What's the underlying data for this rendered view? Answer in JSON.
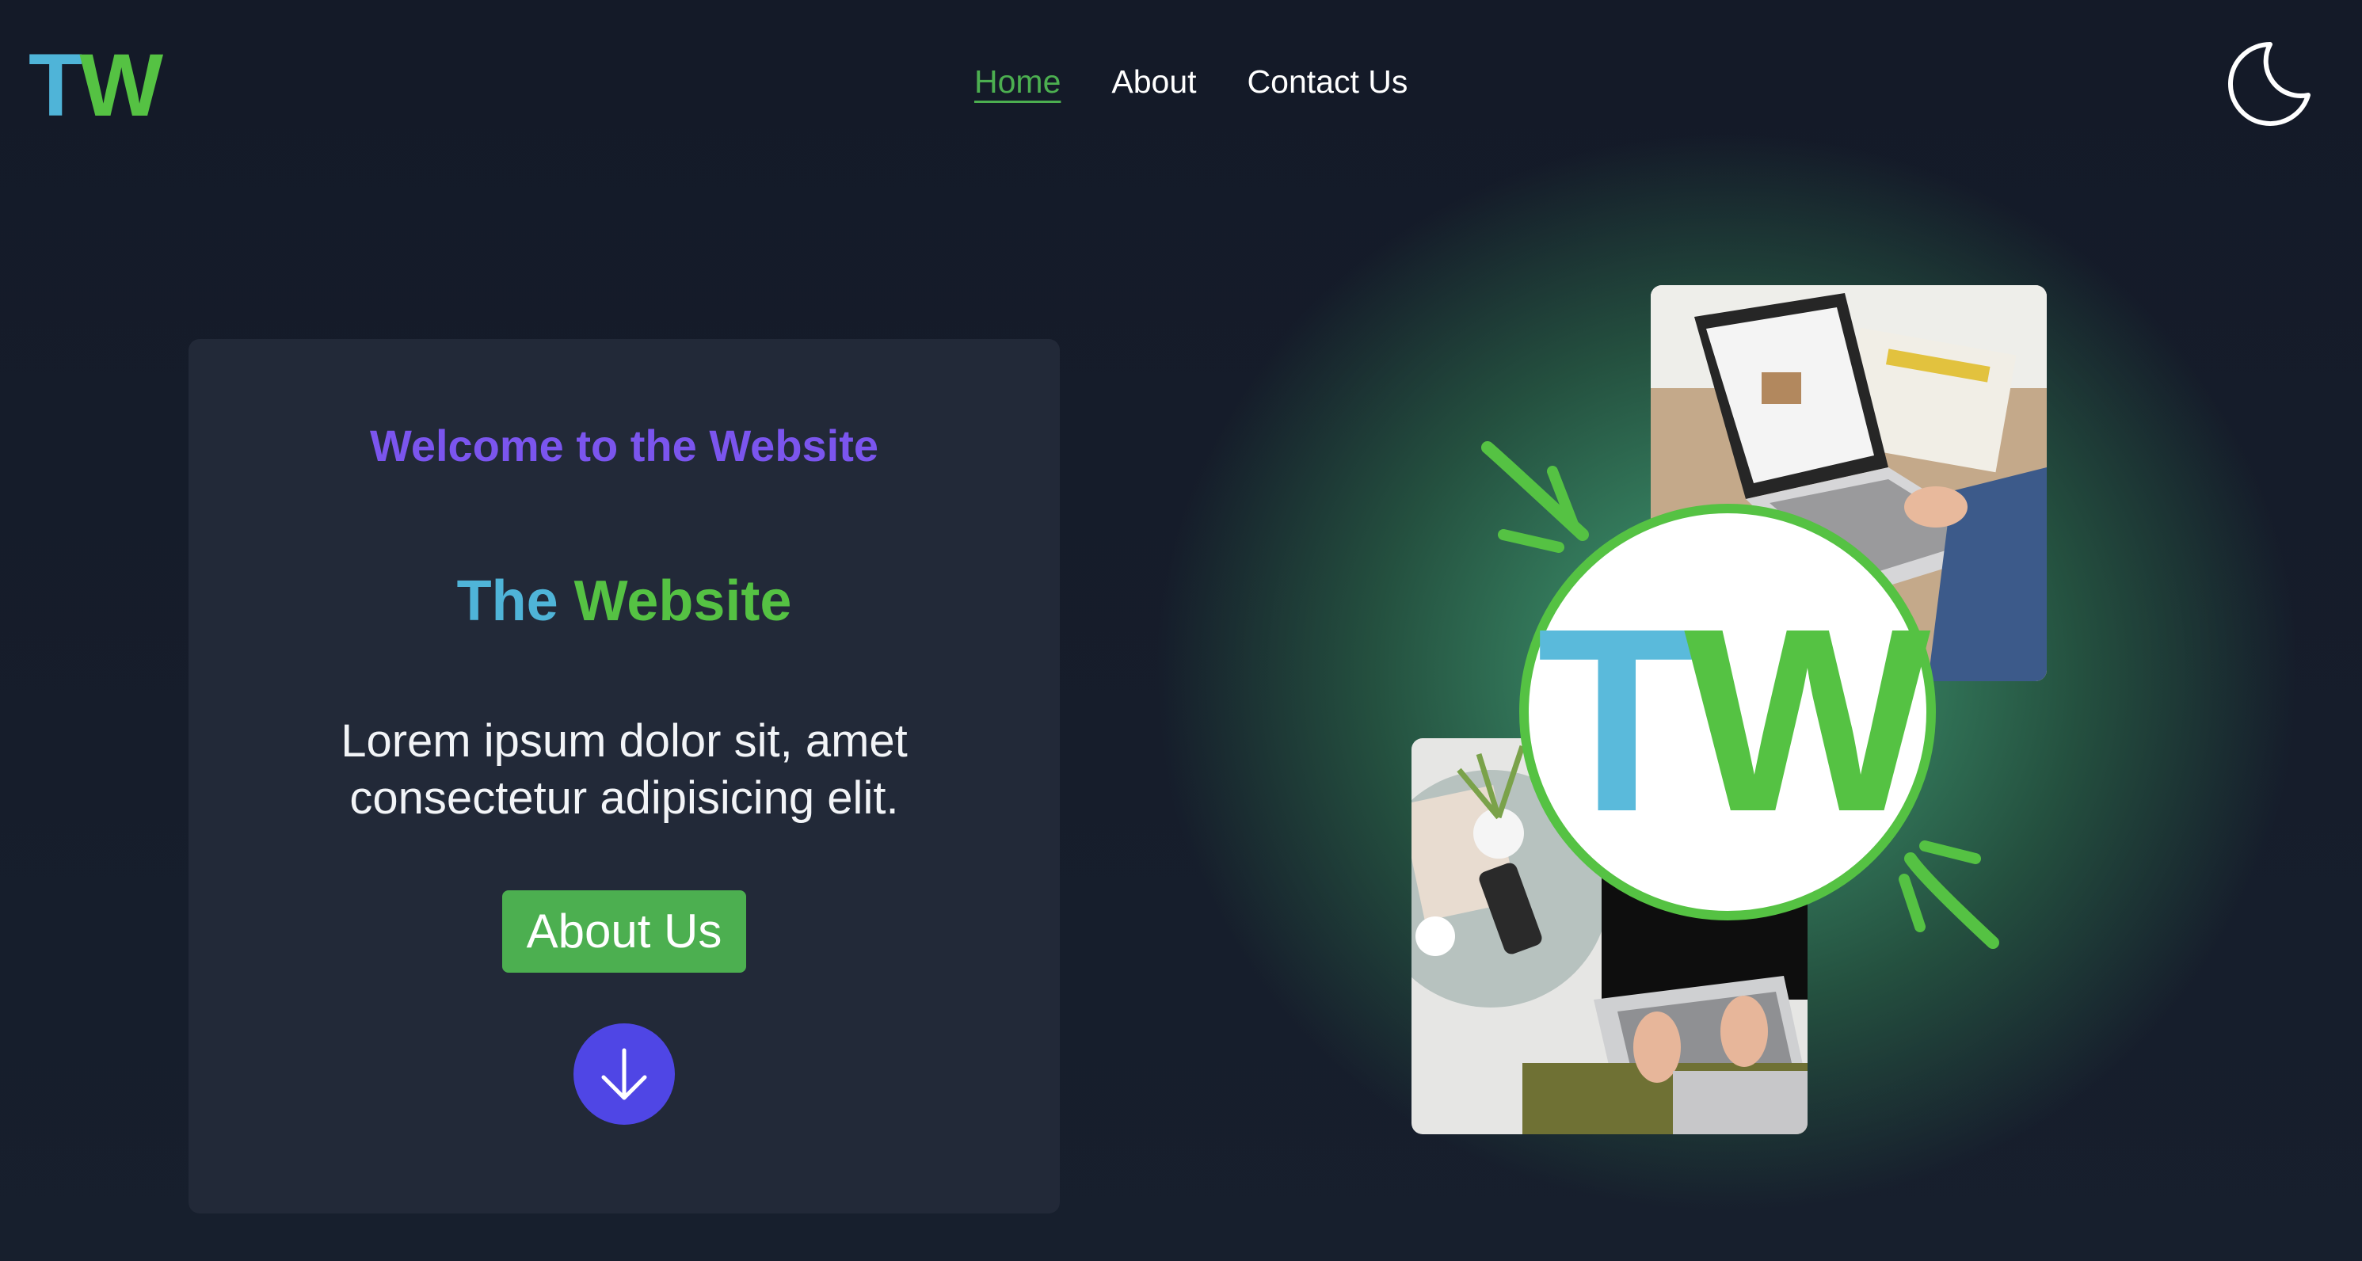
{
  "header": {
    "logo": {
      "t": "T",
      "w": "W"
    },
    "nav": [
      {
        "label": "Home",
        "active": true
      },
      {
        "label": "About",
        "active": false
      },
      {
        "label": "Contact Us",
        "active": false
      }
    ],
    "theme_toggle_icon": "moon-icon"
  },
  "hero": {
    "welcome": "Welcome to the Website",
    "title_part1": "The",
    "title_part2": "Website",
    "description_line1": "Lorem ipsum dolor sit, amet",
    "description_line2": "consectetur adipisicing elit.",
    "about_button": "About Us",
    "scroll_icon": "arrow-down-icon"
  },
  "collage": {
    "badge": {
      "t": "T",
      "w": "W"
    }
  },
  "colors": {
    "accent_blue": "#4fb4d8",
    "accent_green": "#55c243",
    "welcome_purple": "#7b55ee",
    "button_green": "#4caf50",
    "scroll_button": "#4f46e5",
    "card_bg": "#222938",
    "page_bg": "#141a28"
  }
}
